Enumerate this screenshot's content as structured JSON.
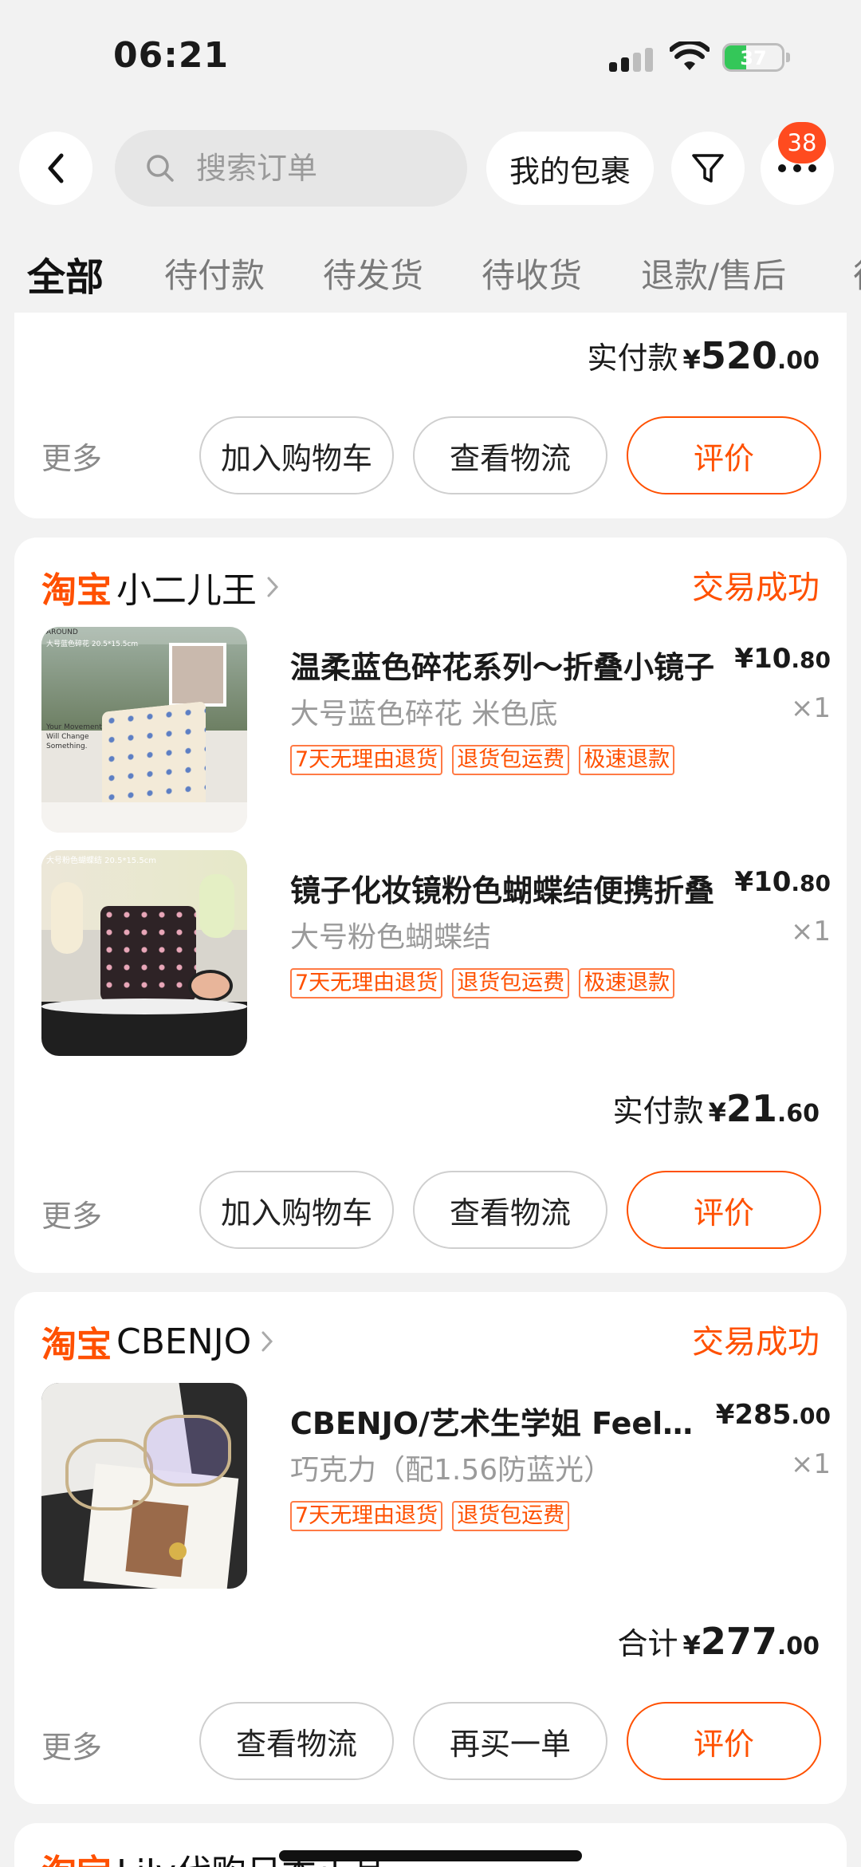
{
  "status_bar": {
    "time": "06:21",
    "battery": "37"
  },
  "header": {
    "search_placeholder": "搜索订单",
    "packages_label": "我的包裹",
    "message_badge": "38"
  },
  "tabs": [
    "全部",
    "待付款",
    "待发货",
    "待收货",
    "退款/售后"
  ],
  "cards": [
    {
      "total_label": "实付款",
      "total_yen": "¥",
      "total_int": "520",
      "total_dec": ".00",
      "more": "更多",
      "actions": [
        "加入购物车",
        "查看物流",
        "评价"
      ]
    },
    {
      "brand": "淘宝",
      "shop": "小二儿王",
      "status": "交易成功",
      "items": [
        {
          "title": "温柔蓝色碎花系列～折叠小镜子",
          "price_yen": "¥",
          "price_int": "10",
          "price_dec": ".80",
          "spec": "大号蓝色碎花 米色底",
          "qty": "×1",
          "tags": [
            "7天无理由退货",
            "退货包运费",
            "极速退款"
          ],
          "thumb_text": "AROUND",
          "thumb_caption_1": "大号蓝色碎花 20.5*15.5cm",
          "thumb_caption_2": "Your Movement Will Change Something."
        },
        {
          "title": "镜子化妆镜粉色蝴蝶结便携折叠",
          "price_yen": "¥",
          "price_int": "10",
          "price_dec": ".80",
          "spec": "大号粉色蝴蝶结",
          "qty": "×1",
          "tags": [
            "7天无理由退货",
            "退货包运费",
            "极速退款"
          ],
          "thumb_caption_1": "大号粉色蝴蝶结 20.5*15.5cm"
        }
      ],
      "total_label": "实付款",
      "total_yen": "¥",
      "total_int": "21",
      "total_dec": ".60",
      "more": "更多",
      "actions": [
        "加入购物车",
        "查看物流",
        "评价"
      ]
    },
    {
      "brand": "淘宝",
      "shop": "CBENJO",
      "status": "交易成功",
      "items": [
        {
          "title": "CBENJO/艺术生学姐 Feel眼镜框",
          "price_yen": "¥",
          "price_int": "285",
          "price_dec": ".00",
          "spec": "巧克力（配1.56防蓝光）",
          "qty": "×1",
          "tags": [
            "7天无理由退货",
            "退货包运费"
          ]
        }
      ],
      "total_label": "合计",
      "total_yen": "¥",
      "total_int": "277",
      "total_dec": ".00",
      "more": "更多",
      "actions": [
        "查看物流",
        "再买一单",
        "评价"
      ]
    },
    {
      "brand": "淘宝",
      "shop": "Lily代购日本正品"
    }
  ],
  "colors": {
    "accent": "#ff5000",
    "badge": "#ff4b1f",
    "battery": "#34c759"
  }
}
